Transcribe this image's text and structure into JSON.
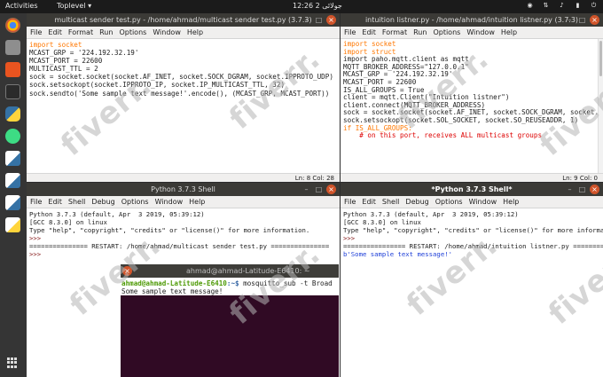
{
  "topbar": {
    "activities": "Activities",
    "app": "Toplevel ▾",
    "clock": "12:26  2 جولائی"
  },
  "sender_editor": {
    "title": "multicast sender test.py - /home/ahmad/multicast sender test.py (3.7.3)",
    "menu": [
      "File",
      "Edit",
      "Format",
      "Run",
      "Options",
      "Window",
      "Help"
    ],
    "status": "Ln: 8   Col: 28",
    "lines": [
      "import socket",
      "",
      "MCAST_GRP = '224.192.32.19'",
      "MCAST_PORT = 22600",
      "MULTICAST_TTL = 2",
      "",
      "sock = socket.socket(socket.AF_INET, socket.SOCK_DGRAM, socket.IPPROTO_UDP)",
      "sock.setsockopt(socket.IPPROTO_IP, socket.IP_MULTICAST_TTL, 32)",
      "sock.sendto('Some sample text message!'.encode(), (MCAST_GRP, MCAST_PORT))"
    ]
  },
  "listener_editor": {
    "title": "intuition listner.py - /home/ahmad/intuition listner.py (3.7.3)",
    "menu": [
      "File",
      "Edit",
      "Format",
      "Run",
      "Options",
      "Window",
      "Help"
    ],
    "status": "Ln: 9   Col: 0",
    "lines": [
      "import socket",
      "import struct",
      "import paho.mqtt.client as mqtt",
      "",
      "MQTT_BROKER_ADDRESS=\"127.0.0.1\"",
      "MCAST_GRP = '224.192.32.19'",
      "MCAST_PORT = 22600",
      "IS_ALL_GROUPS = True",
      "",
      "client = mqtt.Client(\"Intuition listner\")",
      "client.connect(MQTT_BROKER_ADDRESS)",
      "",
      "sock = socket.socket(socket.AF_INET, socket.SOCK_DGRAM, socket.IPPROTO_UDP)",
      "sock.setsockopt(socket.SOL_SOCKET, socket.SO_REUSEADDR, 1)",
      "if IS_ALL_GROUPS:",
      "    # on this port, receives ALL multicast groups"
    ]
  },
  "shell_left": {
    "title": "Python 3.7.3 Shell",
    "menu": [
      "File",
      "Edit",
      "Shell",
      "Debug",
      "Options",
      "Window",
      "Help"
    ],
    "lines": [
      "Python 3.7.3 (default, Apr  3 2019, 05:39:12)",
      "[GCC 8.3.0] on linux",
      "Type \"help\", \"copyright\", \"credits\" or \"license()\" for more information.",
      ">>> ",
      "=============== RESTART: /home/ahmad/multicast sender test.py ===============",
      ">>> "
    ]
  },
  "shell_right": {
    "title": "*Python 3.7.3 Shell*",
    "menu": [
      "File",
      "Edit",
      "Shell",
      "Debug",
      "Options",
      "Window",
      "Help"
    ],
    "lines": [
      "Python 3.7.3 (default, Apr  3 2019, 05:39:12)",
      "[GCC 8.3.0] on linux",
      "Type \"help\", \"copyright\", \"credits\" or \"license()\" for more informati",
      ">>> ",
      "================ RESTART: /home/ahmad/intuition listner.py ================",
      "b'Some sample text message!'"
    ]
  },
  "terminal": {
    "title": "ahmad@ahmad-Latitude-E6410: ~",
    "prompt_user": "ahmad@ahmad-Latitude-E6410",
    "prompt_path": ":~$",
    "command": " mosquitto_sub -t Broad",
    "output": "Some sample text message!"
  },
  "watermark": "fiverr.",
  "colors": {
    "keyword": "#ff7700",
    "string": "#00aa00",
    "builtin": "#1e3fd8",
    "terminal_bg": "#300a24",
    "close_button": "#d0542a"
  },
  "dock_icons": [
    "chrome-icon",
    "files-icon",
    "software-center-icon",
    "terminal-icon",
    "python-icon",
    "android-studio-icon",
    "idle-icon",
    "idle-icon",
    "idle-icon",
    "idle-icon",
    "show-apps-icon"
  ]
}
